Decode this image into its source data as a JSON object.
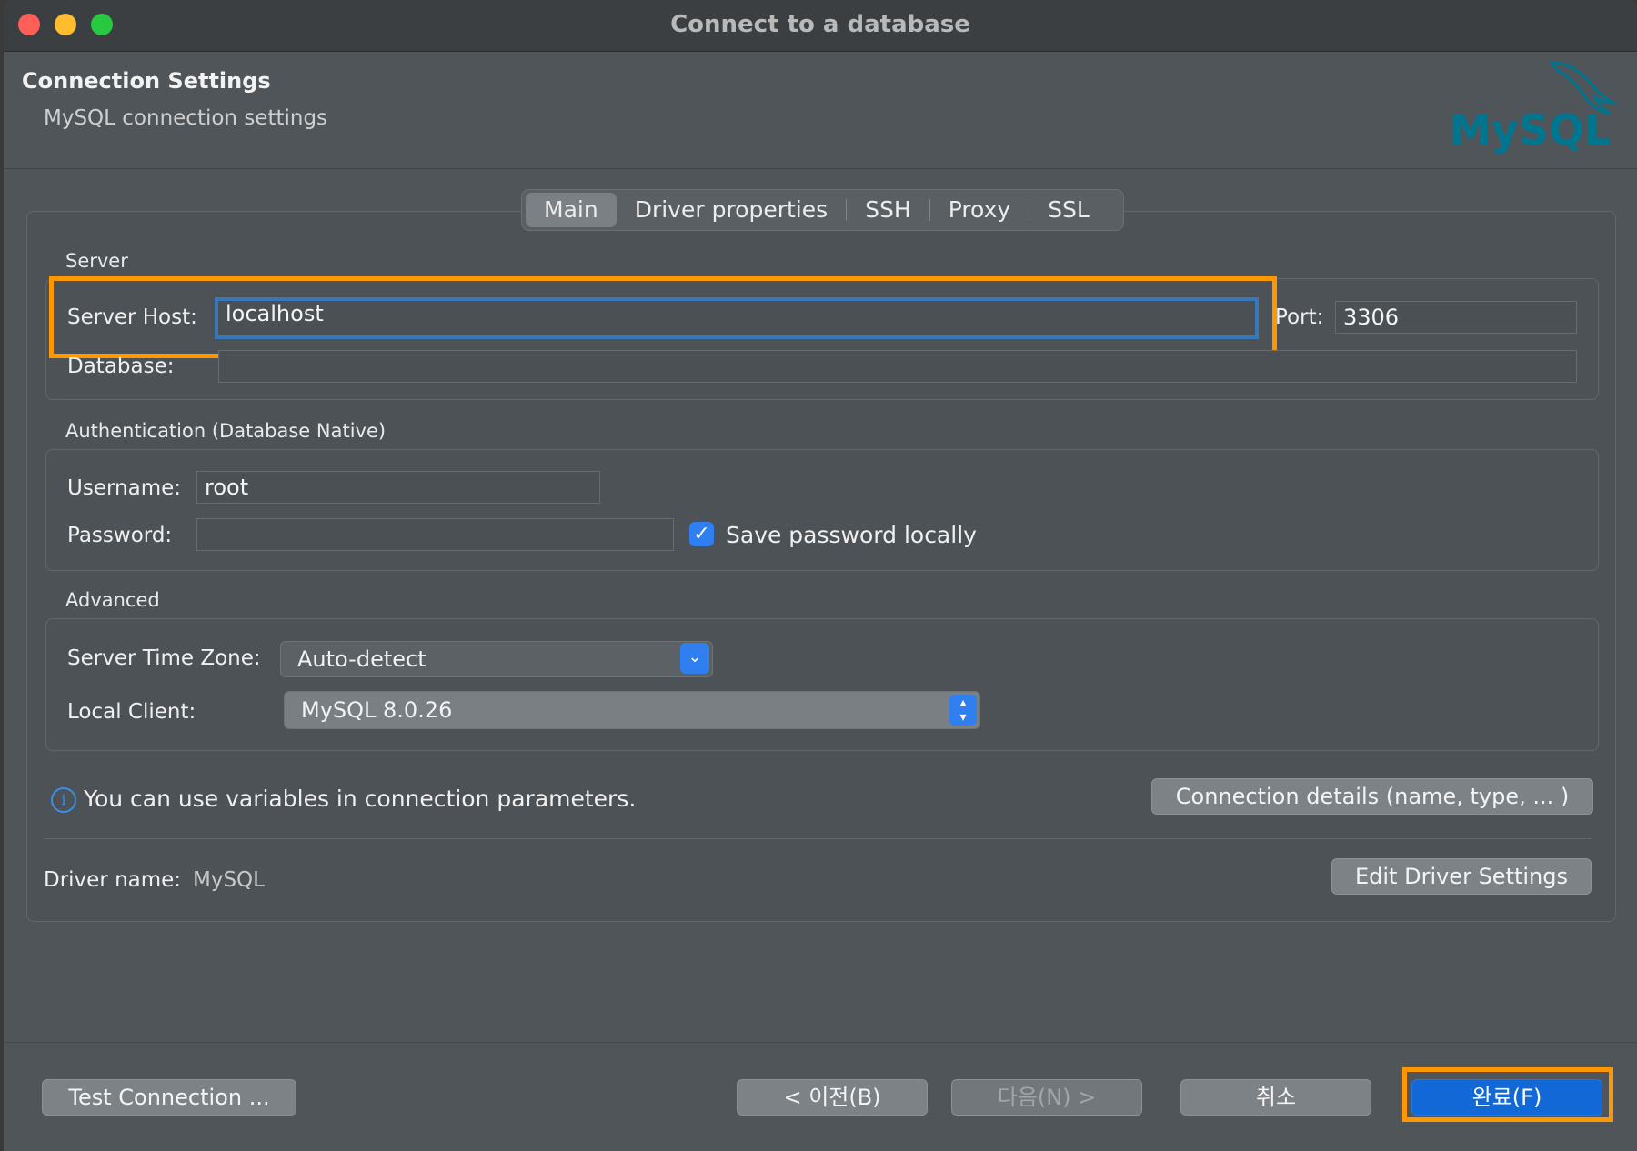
{
  "window": {
    "title": "Connect to a database"
  },
  "header": {
    "title": "Connection Settings",
    "subtitle": "MySQL connection settings",
    "logo_text": "MySQL"
  },
  "tabs": [
    {
      "label": "Main",
      "active": true
    },
    {
      "label": "Driver properties"
    },
    {
      "label": "SSH"
    },
    {
      "label": "Proxy"
    },
    {
      "label": "SSL"
    }
  ],
  "server": {
    "section": "Server",
    "host_label": "Server Host:",
    "host_value": "localhost",
    "port_label": "Port:",
    "port_value": "3306",
    "database_label": "Database:",
    "database_value": ""
  },
  "auth": {
    "section": "Authentication (Database Native)",
    "username_label": "Username:",
    "username_value": "root",
    "password_label": "Password:",
    "password_value": "",
    "save_password_label": "Save password locally",
    "save_password_checked": true
  },
  "advanced": {
    "section": "Advanced",
    "timezone_label": "Server Time Zone:",
    "timezone_value": "Auto-detect",
    "local_client_label": "Local Client:",
    "local_client_value": "MySQL 8.0.26"
  },
  "info": {
    "text": "You can use variables in connection parameters.",
    "details_button": "Connection details (name, type, ... )"
  },
  "driver": {
    "label": "Driver name:",
    "value": "MySQL",
    "edit_button": "Edit Driver Settings"
  },
  "footer": {
    "test_button": "Test Connection ...",
    "back_button": "< 이전(B)",
    "next_button": "다음(N) >",
    "cancel_button": "취소",
    "finish_button": "완료(F)"
  },
  "colors": {
    "highlight": "#ff9800",
    "accent": "#2f7ff1",
    "logo_teal": "#00758f",
    "logo_orange": "#f29111"
  }
}
